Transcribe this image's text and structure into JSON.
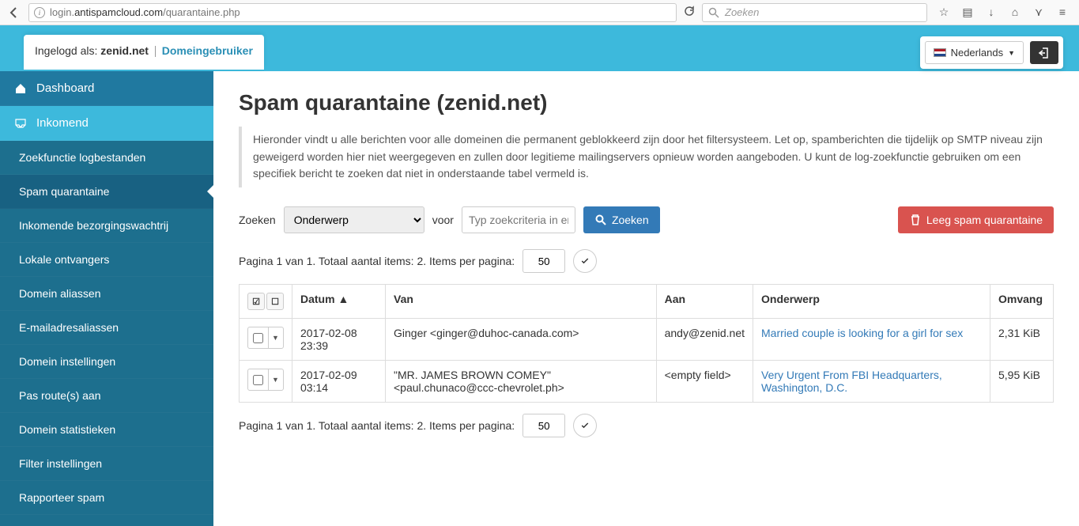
{
  "browser": {
    "url_host": "login.",
    "url_host_bold": "antispamcloud.com",
    "url_path": "/quarantaine.php",
    "search_placeholder": "Zoeken"
  },
  "header": {
    "logged_in_label": "Ingelogd als: ",
    "domain": "zenid.net",
    "role": "Domeingebruiker",
    "language": "Nederlands"
  },
  "sidebar": {
    "dashboard": "Dashboard",
    "incoming": "Inkomend",
    "items": [
      "Zoekfunctie logbestanden",
      "Spam quarantaine",
      "Inkomende bezorgingswachtrij",
      "Lokale ontvangers",
      "Domein aliassen",
      "E-mailadresaliassen",
      "Domein instellingen",
      "Pas route(s) aan",
      "Domein statistieken",
      "Filter instellingen",
      "Rapporteer spam"
    ]
  },
  "main": {
    "title": "Spam quarantaine (zenid.net)",
    "intro": "Hieronder vindt u alle berichten voor alle domeinen die permanent geblokkeerd zijn door het filtersysteem. Let op, spamberichten die tijdelijk op SMTP niveau zijn geweigerd worden hier niet weergegeven en zullen door legitieme mailingservers opnieuw worden aangeboden. U kunt de log-zoekfunctie gebruiken om een specifiek bericht te zoeken dat niet in onderstaande tabel vermeld is.",
    "search_label": "Zoeken",
    "search_field_option": "Onderwerp",
    "for_label": "voor",
    "criteria_placeholder": "Typ zoekcriteria in en",
    "search_button": "Zoeken",
    "empty_button": "Leeg spam quarantaine",
    "pager_text": "Pagina 1 van 1. Totaal aantal items: 2. Items per pagina:",
    "items_per_page": "50",
    "columns": {
      "date": "Datum ▲",
      "from": "Van",
      "to": "Aan",
      "subject": "Onderwerp",
      "size": "Omvang"
    },
    "rows": [
      {
        "date": "2017-02-08 23:39",
        "from": "Ginger <ginger@duhoc-canada.com>",
        "to": "andy@zenid.net",
        "subject": "Married couple is looking for a girl for sex",
        "size": "2,31 KiB"
      },
      {
        "date": "2017-02-09 03:14",
        "from": "\"MR. JAMES BROWN COMEY\" <paul.chunaco@ccc-chevrolet.ph>",
        "to": "<empty field>",
        "subject": "Very Urgent From FBI Headquarters, Washington, D.C.",
        "size": "5,95 KiB"
      }
    ]
  }
}
